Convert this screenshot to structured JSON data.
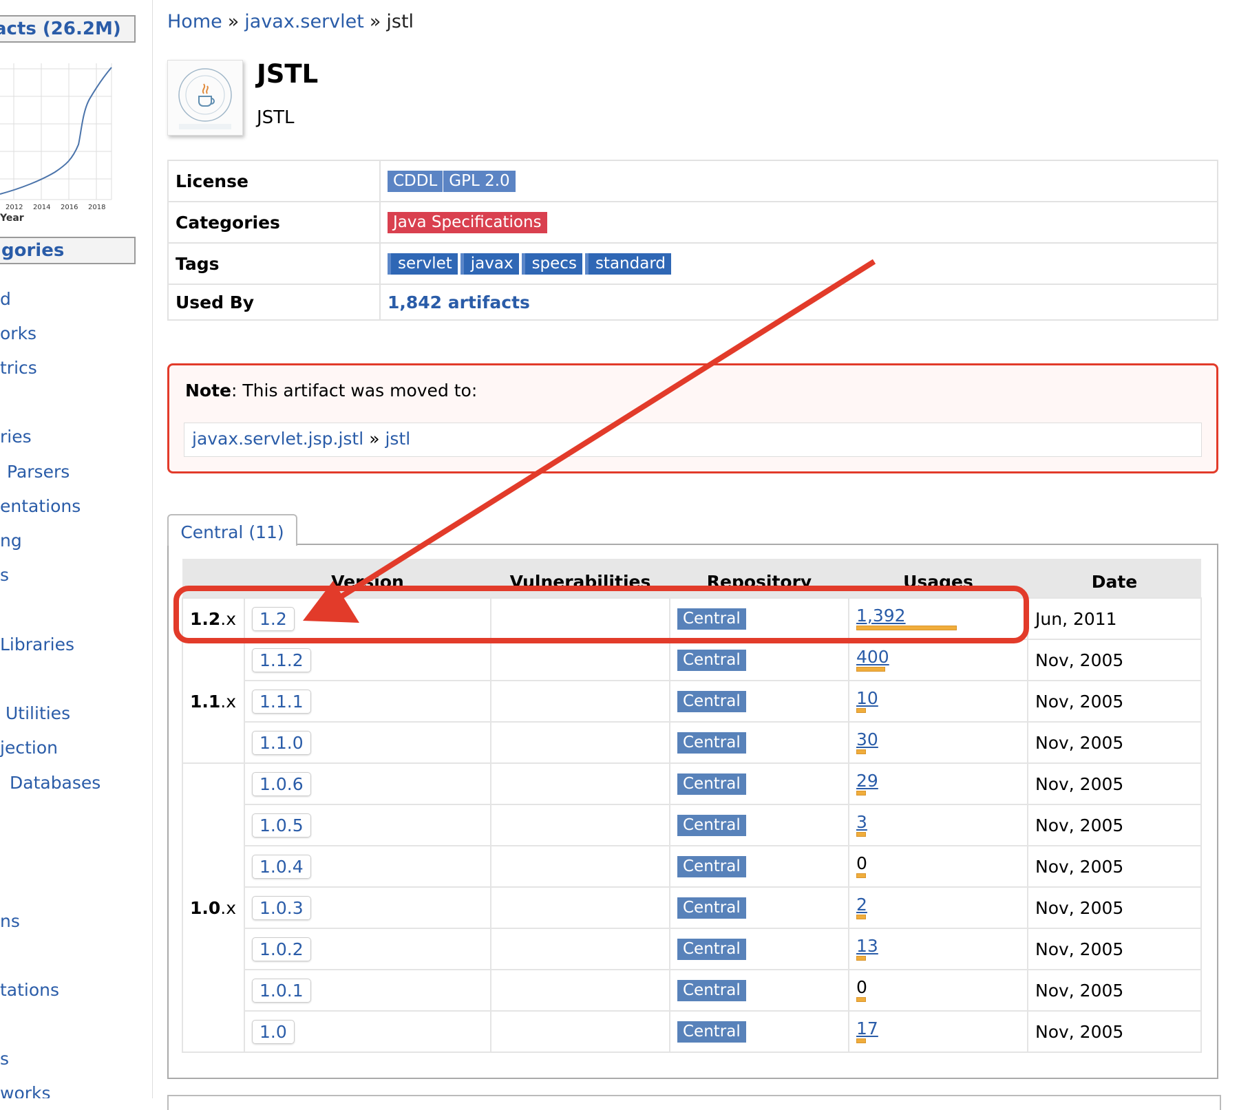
{
  "sidebar": {
    "artifacts_heading": "acts (26.2M)",
    "chart": {
      "x_ticks": [
        "2012",
        "2014",
        "2016",
        "2018"
      ],
      "x_label": "Year"
    },
    "categories_heading": "gories",
    "links": [
      "d",
      "orks",
      "trics",
      "ries",
      "Parsers",
      "entations",
      "ng",
      "s",
      "Libraries",
      "Utilities",
      "jection",
      "Databases",
      "ns",
      "tations",
      "s",
      "works"
    ]
  },
  "breadcrumb": {
    "home": "Home",
    "sep": "»",
    "group": "javax.servlet",
    "current": "jstl"
  },
  "artifact": {
    "title": "JSTL",
    "subtitle": "JSTL",
    "logo_icon": "java-community-process-logo-icon"
  },
  "info": {
    "license_label": "License",
    "licenses": [
      "CDDL",
      "GPL 2.0"
    ],
    "categories_label": "Categories",
    "categories": [
      "Java Specifications"
    ],
    "tags_label": "Tags",
    "tags": [
      "servlet",
      "javax",
      "specs",
      "standard"
    ],
    "used_by_label": "Used By",
    "used_by": "1,842 artifacts"
  },
  "note": {
    "label": "Note",
    "text": ": This artifact was moved to:",
    "target_group": "javax.servlet.jsp.jstl",
    "sep": "»",
    "target_artifact": "jstl"
  },
  "versions": {
    "tab_label": "Central (11)",
    "headers": [
      "Version",
      "Vulnerabilities",
      "Repository",
      "Usages",
      "Date"
    ],
    "groups": [
      {
        "major": "1.2",
        "suffix": ".x",
        "rows": [
          {
            "version": "1.2",
            "repo": "Central",
            "usages": "1,392",
            "usages_value": 1392,
            "date": "Jun, 2011"
          }
        ]
      },
      {
        "major": "1.1",
        "suffix": ".x",
        "rows": [
          {
            "version": "1.1.2",
            "repo": "Central",
            "usages": "400",
            "usages_value": 400,
            "date": "Nov, 2005"
          },
          {
            "version": "1.1.1",
            "repo": "Central",
            "usages": "10",
            "usages_value": 10,
            "date": "Nov, 2005"
          },
          {
            "version": "1.1.0",
            "repo": "Central",
            "usages": "30",
            "usages_value": 30,
            "date": "Nov, 2005"
          }
        ]
      },
      {
        "major": "1.0",
        "suffix": ".x",
        "rows": [
          {
            "version": "1.0.6",
            "repo": "Central",
            "usages": "29",
            "usages_value": 29,
            "date": "Nov, 2005"
          },
          {
            "version": "1.0.5",
            "repo": "Central",
            "usages": "3",
            "usages_value": 3,
            "date": "Nov, 2005"
          },
          {
            "version": "1.0.4",
            "repo": "Central",
            "usages": "0",
            "usages_value": 0,
            "date": "Nov, 2005"
          },
          {
            "version": "1.0.3",
            "repo": "Central",
            "usages": "2",
            "usages_value": 2,
            "date": "Nov, 2005"
          },
          {
            "version": "1.0.2",
            "repo": "Central",
            "usages": "13",
            "usages_value": 13,
            "date": "Nov, 2005"
          },
          {
            "version": "1.0.1",
            "repo": "Central",
            "usages": "0",
            "usages_value": 0,
            "date": "Nov, 2005"
          },
          {
            "version": "1.0",
            "repo": "Central",
            "usages": "17",
            "usages_value": 17,
            "date": "Nov, 2005"
          }
        ]
      }
    ]
  },
  "colors": {
    "link": "#2a5ca8",
    "annotation_red": "#e23b2a",
    "usage_bar": "#f0ad3c",
    "license_badge": "#5b84c4",
    "category_badge": "#d9404f",
    "repo_badge": "#5882ba"
  }
}
